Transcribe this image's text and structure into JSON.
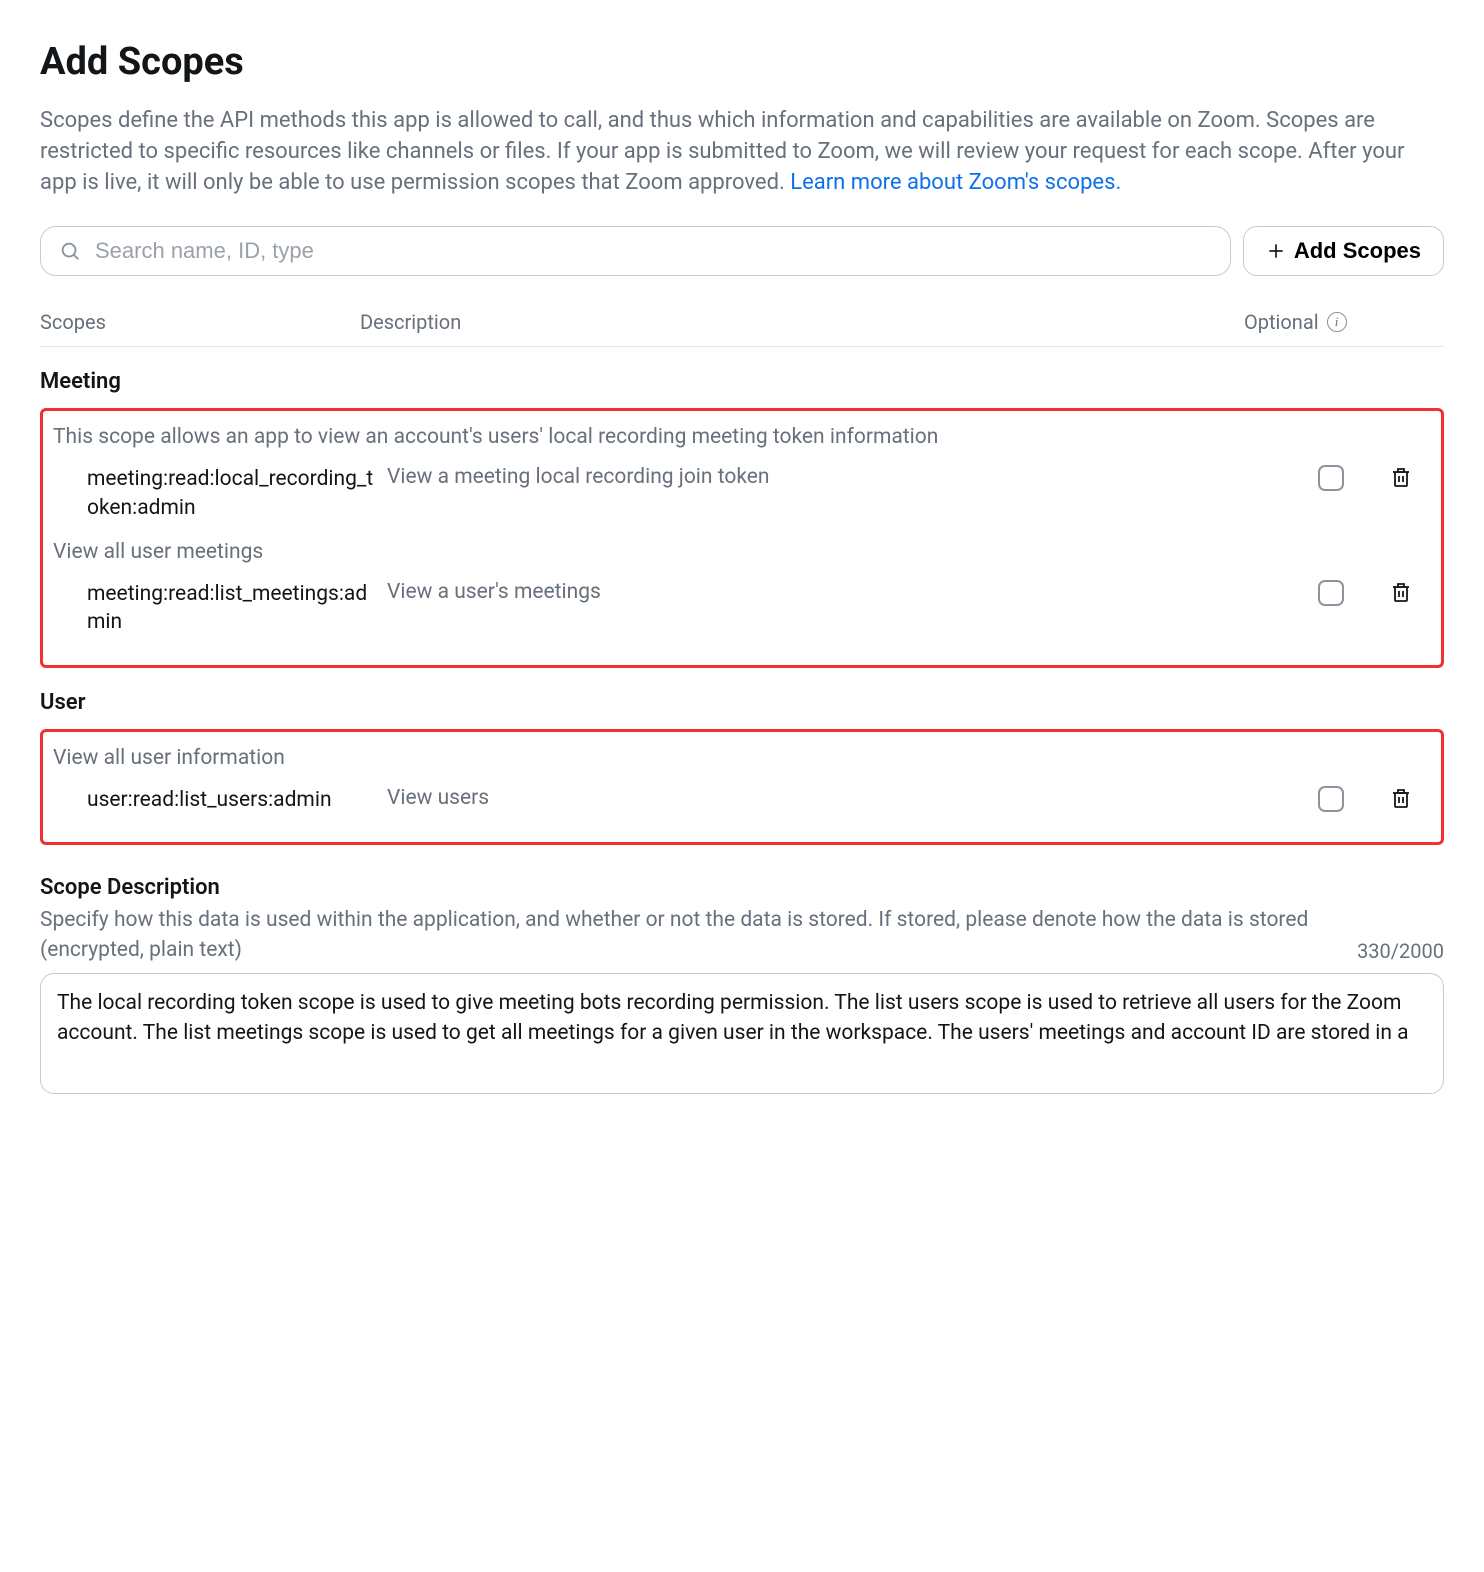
{
  "header": {
    "title": "Add Scopes",
    "intro": "Scopes define the API methods this app is allowed to call, and thus which information and capabilities are available on Zoom. Scopes are restricted to specific resources like channels or files. If your app is submitted to Zoom, we will review your request for each scope. After your app is live, it will only be able to use permission scopes that Zoom approved. ",
    "learn_more": "Learn more about Zoom's scopes."
  },
  "search": {
    "placeholder": "Search name, ID, type"
  },
  "buttons": {
    "add_scopes": "Add Scopes"
  },
  "table_headers": {
    "scopes": "Scopes",
    "description": "Description",
    "optional": "Optional"
  },
  "categories": [
    {
      "name": "Meeting",
      "groups": [
        {
          "desc": "This scope allows an app to view an account's users' local recording meeting token information",
          "items": [
            {
              "id": "meeting:read:local_recording_token:admin",
              "desc": "View a meeting local recording join token"
            }
          ]
        },
        {
          "desc": "View all user meetings",
          "items": [
            {
              "id": "meeting:read:list_meetings:admin",
              "desc": "View a user's meetings"
            }
          ]
        }
      ]
    },
    {
      "name": "User",
      "groups": [
        {
          "desc": "View all user information",
          "items": [
            {
              "id": "user:read:list_users:admin",
              "desc": "View users"
            }
          ]
        }
      ]
    }
  ],
  "scope_description": {
    "heading": "Scope Description",
    "sub": "Specify how this data is used within the application, and whether or not the data is stored. If stored, please denote how the data is stored (encrypted, plain text)",
    "counter": "330/2000",
    "value": "The local recording token scope is used to give meeting bots recording permission. The list users scope is used to retrieve all users for the Zoom account. The list meetings scope is used to get all meetings for a given user in the workspace. The users' meetings and account ID are stored in a"
  }
}
